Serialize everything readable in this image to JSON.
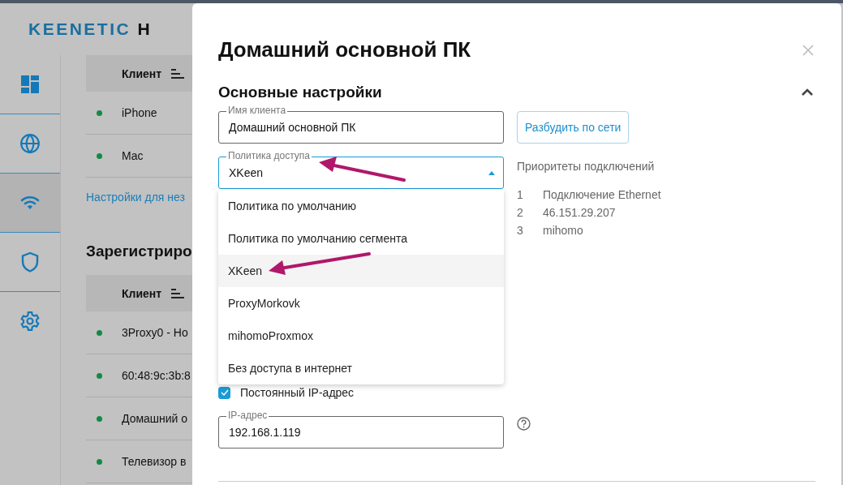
{
  "background": {
    "logo": {
      "brand": "KEENETIC",
      "suffix": "H"
    },
    "sidebar": [
      {
        "selected": false
      },
      {
        "selected": false
      },
      {
        "selected": true
      },
      {
        "selected": false
      },
      {
        "selected": false
      }
    ],
    "table_1": {
      "header": "Клиент",
      "rows": [
        {
          "name": "iPhone",
          "online": true
        },
        {
          "name": "Mac",
          "online": true
        }
      ]
    },
    "link": "Настройки для нез",
    "section_title": "Зарегистриро",
    "table_2": {
      "header": "Клиент",
      "rows": [
        {
          "name": "3Proxy0 - Ho",
          "online": true
        },
        {
          "name": "60:48:9c:3b:8",
          "online": true
        },
        {
          "name": "Домашний о",
          "online": true
        },
        {
          "name": "Телевизор в",
          "online": true
        }
      ]
    }
  },
  "dialog": {
    "title": "Домашний основной ПК",
    "section": {
      "title": "Основные настройки",
      "expanded": true
    },
    "client_name": {
      "label": "Имя клиента",
      "value": "Домашний основной ПК"
    },
    "wake_button": "Разбудить по сети",
    "access_policy": {
      "label": "Политика доступа",
      "value": "XKeen",
      "open": true,
      "options": [
        {
          "label": "Политика по умолчанию",
          "selected": false
        },
        {
          "label": "Политика по умолчанию сегмента",
          "selected": false
        },
        {
          "label": "XKeen",
          "selected": true
        },
        {
          "label": "ProxyMorkovk",
          "selected": false
        },
        {
          "label": "mihomoProxmox",
          "selected": false
        },
        {
          "label": "Без доступа в интернет",
          "selected": false
        }
      ]
    },
    "priorities": {
      "title": "Приоритеты подключений",
      "items": [
        {
          "number": "1",
          "name": "Подключение Ethernet"
        },
        {
          "number": "2",
          "name": "46.151.29.207"
        },
        {
          "number": "3",
          "name": "mihomo"
        }
      ]
    },
    "static_ip": {
      "label": "Постоянный IP-адрес",
      "checked": true
    },
    "ip_address": {
      "label": "IP-адрес",
      "value": "192.168.1.119"
    }
  }
}
